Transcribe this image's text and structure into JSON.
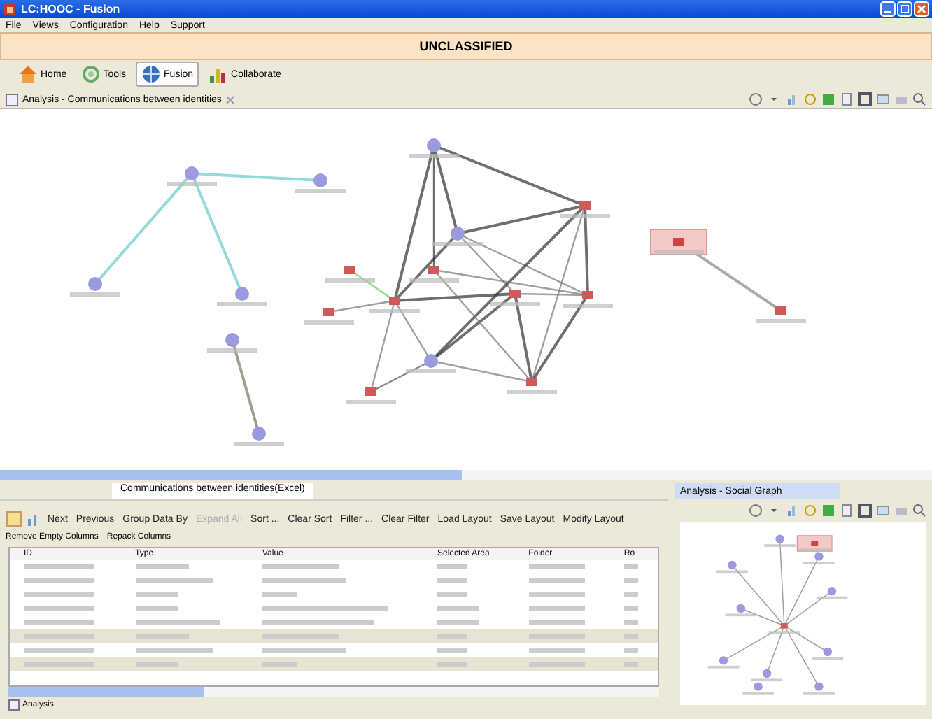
{
  "window": {
    "title": "LC:HOOC - Fusion"
  },
  "menu": [
    "File",
    "Views",
    "Configuration",
    "Help",
    "Support"
  ],
  "banner": "UNCLASSIFIED",
  "perspectives": [
    {
      "label": "Home",
      "selected": false
    },
    {
      "label": "Tools",
      "selected": false
    },
    {
      "label": "Fusion",
      "selected": true
    },
    {
      "label": "Collaborate",
      "selected": false
    }
  ],
  "main_view": {
    "tab": "Analysis - Communications between identities"
  },
  "bottom_panel": {
    "tabs": [
      {
        "label": "Communications between identities(Excel)",
        "selected": true
      }
    ],
    "toolbar": [
      {
        "label": "Next",
        "disabled": false
      },
      {
        "label": "Previous",
        "disabled": false
      },
      {
        "label": "Group Data By",
        "disabled": false
      },
      {
        "label": "Expand All",
        "disabled": true
      },
      {
        "label": "Sort ...",
        "disabled": false
      },
      {
        "label": "Clear Sort",
        "disabled": false
      },
      {
        "label": "Filter ...",
        "disabled": false
      },
      {
        "label": "Clear Filter",
        "disabled": false
      },
      {
        "label": "Load Layout",
        "disabled": false
      },
      {
        "label": "Save Layout",
        "disabled": false
      },
      {
        "label": "Modify Layout",
        "disabled": false
      }
    ],
    "actions": [
      "Remove Empty Columns",
      "Repack Columns"
    ],
    "table": {
      "columns": [
        "ID",
        "Type",
        "Value",
        "Selected Area",
        "Folder",
        "Ro"
      ],
      "rows": [
        {
          "kind": "plain"
        },
        {
          "kind": "plain"
        },
        {
          "kind": "plain"
        },
        {
          "kind": "plain"
        },
        {
          "kind": "plain"
        },
        {
          "kind": "shaded"
        },
        {
          "kind": "plain"
        },
        {
          "kind": "shaded"
        }
      ]
    },
    "footer_tab": "Analysis"
  },
  "side_view": {
    "tab": "Analysis - Social Graph"
  }
}
